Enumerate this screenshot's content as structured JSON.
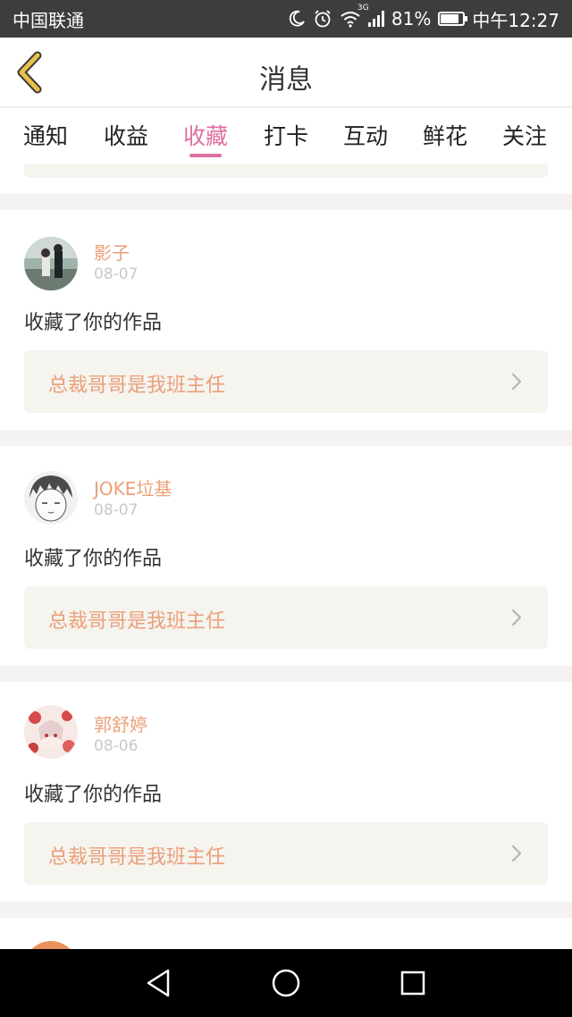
{
  "status_bar": {
    "carrier": "中国联通",
    "network": "3G",
    "battery_percent": "81%",
    "battery_level": 0.81,
    "time": "中午12:27"
  },
  "header": {
    "title": "消息",
    "back_icon": "chevron-left-icon"
  },
  "tabs": [
    {
      "label": "通知",
      "active": false
    },
    {
      "label": "收益",
      "active": false
    },
    {
      "label": "收藏",
      "active": true
    },
    {
      "label": "打卡",
      "active": false
    },
    {
      "label": "互动",
      "active": false
    },
    {
      "label": "鲜花",
      "active": false
    },
    {
      "label": "关注",
      "active": false
    }
  ],
  "items": [
    {
      "name": "影子",
      "date": "08-07",
      "action": "收藏了你的作品",
      "work_title": "总裁哥哥是我班主任"
    },
    {
      "name": "JOKE垃基",
      "date": "08-07",
      "action": "收藏了你的作品",
      "work_title": "总裁哥哥是我班主任"
    },
    {
      "name": "郭舒婷",
      "date": "08-06",
      "action": "收藏了你的作品",
      "work_title": "总裁哥哥是我班主任"
    }
  ],
  "colors": {
    "accent": "#e06fa0",
    "name": "#eba07a",
    "back_icon": "#e8c04a"
  },
  "nav": {
    "back": "triangle-back-icon",
    "home": "circle-home-icon",
    "recents": "square-recents-icon"
  }
}
